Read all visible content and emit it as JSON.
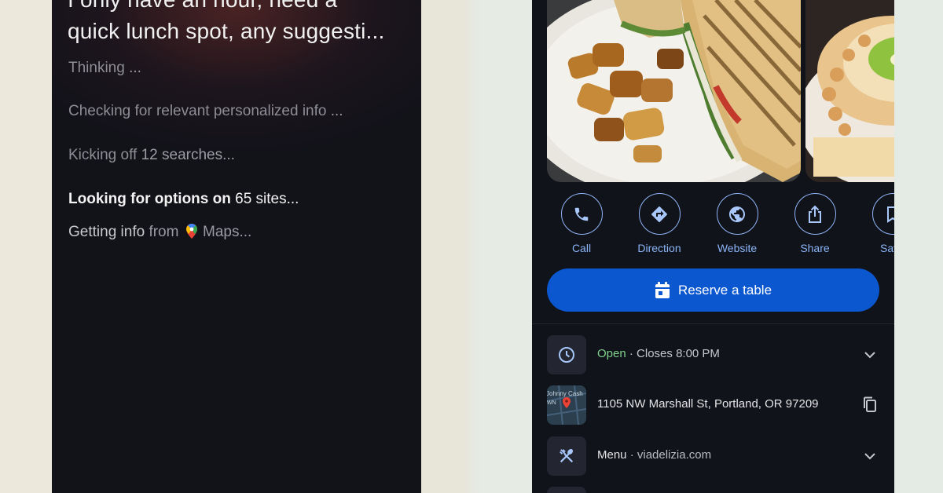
{
  "assistant": {
    "query_lines": [
      "I only have an hour, need a",
      "quick lunch spot, any suggesti..."
    ],
    "steps": [
      {
        "label": "Thinking",
        "detail": "..."
      },
      {
        "label": "Checking for relevant personalized info",
        "detail": "..."
      },
      {
        "label": "Kicking off",
        "detail": "12 searches..."
      },
      {
        "label": "Looking for options on",
        "detail": "65 sites..."
      },
      {
        "label": "Getting info",
        "from": "from",
        "source": "Maps..."
      }
    ]
  },
  "place": {
    "photos": [
      "sandwich-photo",
      "cake-photo"
    ],
    "actions": [
      {
        "label": "Call",
        "icon": "phone-icon"
      },
      {
        "label": "Direction",
        "icon": "directions-icon"
      },
      {
        "label": "Website",
        "icon": "globe-icon"
      },
      {
        "label": "Share",
        "icon": "share-icon"
      },
      {
        "label": "Save",
        "icon": "bookmark-icon"
      }
    ],
    "reserve_label": "Reserve a table",
    "hours": {
      "status": "Open",
      "separator": "·",
      "closes": "Closes 8:00 PM"
    },
    "address": "1105 NW Marshall St, Portland, OR 97209",
    "map_thumb_text": [
      "Johnny Cash",
      "WN"
    ],
    "menu": {
      "label": "Menu",
      "separator": "·",
      "site": "viadelizia.com"
    }
  },
  "colors": {
    "accent": "#8ab4f8",
    "reserve_button": "#0b57d0",
    "open_status": "#7fd18b"
  }
}
